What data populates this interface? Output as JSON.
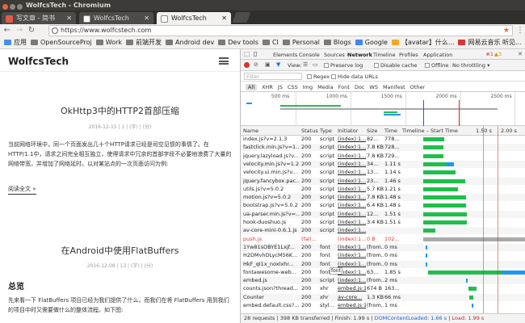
{
  "window": {
    "title": "WolfcsTech - Chromium"
  },
  "tabs": [
    {
      "label": "写文章 - 简书",
      "favicon": "red"
    },
    {
      "label": "WolfcsTech",
      "favicon": "doc"
    },
    {
      "label": "WolfcsTech",
      "favicon": "doc",
      "active": true
    }
  ],
  "toolbar": {
    "url": "https://www.wolfcstech.com"
  },
  "bookmarks": [
    {
      "label": "应用",
      "icon": "apps"
    },
    {
      "label": "OpenSourceProj",
      "icon": "folder"
    },
    {
      "label": "Work",
      "icon": "folder"
    },
    {
      "label": "前端开发",
      "icon": "folder"
    },
    {
      "label": "Android dev",
      "icon": "folder"
    },
    {
      "label": "Dev tools",
      "icon": "folder"
    },
    {
      "label": "CI",
      "icon": "folder"
    },
    {
      "label": "Personal",
      "icon": "folder"
    },
    {
      "label": "Blogs",
      "icon": "folder"
    },
    {
      "label": "Google",
      "icon": "g"
    },
    {
      "label": "【avatar】什么...",
      "icon": "page"
    },
    {
      "label": "网易云音乐 听见...",
      "icon": "music"
    }
  ],
  "site": {
    "title": "WolfcsTech",
    "post1": {
      "title": "OkHttp3中的HTTP2首部压缩",
      "meta": "2016-12-15 | 1 | (字) | (分)",
      "excerpt": "当前网络环境中，同一个页面发出几十个HTTP请求已经是司空见惯的事情了。在HTTP/1.1中，请求之间完全相互独立，使得请求中冗余的首部字段不必要地浪费了大量的网络带宽，并增加了网络延时。以对某站点的一次页面访问为例:",
      "more": "阅读全文 »"
    },
    "post2": {
      "title": "在Android中使用FlatBuffers",
      "meta": "2016-12-08 | 13 | (字) | (分)",
      "section": "总览",
      "excerpt": "先来看一下 FlatBuffers 项目已经为我们提供了什么，而我们在将 FlatBuffers 用到我们的项目中时又需要做什么的整体流程。如下图:"
    }
  },
  "devtools": {
    "tabs": [
      "Elements",
      "Console",
      "Sources",
      "Network",
      "Timeline",
      "Profiles",
      "Application"
    ],
    "active_tab": "Network",
    "errors": "1",
    "warnings": "3",
    "view_label": "View:",
    "preserve_log": "Preserve log",
    "disable_cache": "Disable cache",
    "offline": "Offline",
    "throttle": "No throttling",
    "filter_placeholder": "Filter",
    "regex": "Regex",
    "hide_data": "Hide data URLs",
    "types": [
      "All",
      "XHR",
      "JS",
      "CSS",
      "Img",
      "Media",
      "Font",
      "Doc",
      "WS",
      "Manifest",
      "Other"
    ],
    "overview_ticks": [
      "500 ms",
      "1000 ms",
      "1500 ms",
      "2000 ms",
      "2500 ms"
    ],
    "columns": {
      "name": "Name",
      "status": "Status",
      "type": "Type",
      "initiator": "Initiator",
      "size": "Size",
      "time": "Time",
      "waterfall": "Timeline – Start Time",
      "w1": "1.50 s",
      "w2": "2.00 s"
    },
    "rows": [
      {
        "name": "index.js?v=2.1.3",
        "status": "200",
        "type": "script",
        "init": "(index):1...",
        "size": "82...",
        "time": "778...",
        "start": 0.14,
        "dur": 0.18,
        "color": "green"
      },
      {
        "name": "fastclick.min.js?v=1...",
        "status": "200",
        "type": "script",
        "init": "(index):1...",
        "size": "7.8 KB",
        "time": "728...",
        "start": 0.14,
        "dur": 0.17,
        "color": "green"
      },
      {
        "name": "jquery.lazyload.js?v...",
        "status": "200",
        "type": "script",
        "init": "(index):1...",
        "size": "7.8 KB",
        "time": "729...",
        "start": 0.14,
        "dur": 0.17,
        "color": "green"
      },
      {
        "name": "velocity.min.js?v=1.2.1",
        "status": "200",
        "type": "script",
        "init": "(index):1...",
        "size": "34...",
        "time": "1.11 s",
        "start": 0.14,
        "dur": 0.26,
        "color": "green_blue"
      },
      {
        "name": "velocity.ui.min.js?v...",
        "status": "200",
        "type": "script",
        "init": "(index):1...",
        "size": "13...",
        "time": "1.14 s",
        "start": 0.14,
        "dur": 0.27,
        "color": "green"
      },
      {
        "name": "jquery.fancybox.pac...",
        "status": "200",
        "type": "script",
        "init": "(index):1...",
        "size": "23...",
        "time": "1.46 s",
        "start": 0.14,
        "dur": 0.35,
        "color": "green"
      },
      {
        "name": "utils.js?v=5.0.2",
        "status": "200",
        "type": "script",
        "init": "(index):1...",
        "size": "5.7 KB",
        "time": "1.21 s",
        "start": 0.14,
        "dur": 0.29,
        "color": "green"
      },
      {
        "name": "motion.js?v=5.0.2",
        "status": "200",
        "type": "script",
        "init": "(index):1...",
        "size": "7.8 KB",
        "time": "1.48 s",
        "start": 0.14,
        "dur": 0.36,
        "color": "green"
      },
      {
        "name": "bootstrap.js?v=5.0.2",
        "status": "200",
        "type": "script",
        "init": "(index):1...",
        "size": "6.4 KB",
        "time": "1.48 s",
        "start": 0.14,
        "dur": 0.36,
        "color": "green"
      },
      {
        "name": "ua-parser.min.js?v=...",
        "status": "200",
        "type": "script",
        "init": "(index):1...",
        "size": "12...",
        "time": "1.51 s",
        "start": 0.14,
        "dur": 0.37,
        "color": "green"
      },
      {
        "name": "hook-duoshuo.js",
        "status": "200",
        "type": "script",
        "init": "(index):1...",
        "size": "3.4 KB",
        "time": "1.51 s",
        "start": 0.14,
        "dur": 0.37,
        "color": "green"
      },
      {
        "name": "av-core-mini-0.6.1.js",
        "status": "200",
        "type": "script",
        "init": "(index):1...",
        "size": "",
        "time": "",
        "start": 0.14,
        "dur": 0.1,
        "color": "green"
      },
      {
        "name": "push.js",
        "status": "(fail...",
        "type": "",
        "init": "(index):1...",
        "size": "0 B",
        "time": "102...",
        "start": 0.14,
        "dur": 0.86,
        "color": "gray",
        "failed": true
      },
      {
        "name": "1Yw81sOBYE1Lxjf...",
        "status": "200",
        "type": "font",
        "init": "(index):1...",
        "size": "(from...",
        "time": "0 ms",
        "start": 0.16,
        "dur": 0.01,
        "color": "blue"
      },
      {
        "name": "H2DMvhDLycM56K...",
        "status": "200",
        "type": "font",
        "init": "(index):1...",
        "size": "(from...",
        "time": "0 ms",
        "start": 0.16,
        "dur": 0.01,
        "color": "blue"
      },
      {
        "name": "HkF_qI1x_noxlxhr...",
        "status": "200",
        "type": "font",
        "init": "(index):1...",
        "size": "(from...",
        "time": "0 ms",
        "start": 0.16,
        "dur": 0.01,
        "color": "blue"
      },
      {
        "name": "fontawesome-web...",
        "status": "200",
        "type": "font",
        "init": "(index):1...",
        "size": "63...",
        "time": "1.85 s",
        "start": 0.18,
        "dur": 0.82,
        "color": "green_blue"
      },
      {
        "name": "embed.js",
        "status": "200",
        "type": "script",
        "init": "(index):1...",
        "size": "(from...",
        "time": "2 ms",
        "start": 0.5,
        "dur": 0.01,
        "color": "blue"
      },
      {
        "name": "counts.json?thread...",
        "status": "200",
        "type": "xhr",
        "init": "embed.js:1",
        "size": "674 B",
        "time": "163...",
        "start": 0.52,
        "dur": 0.07,
        "color": "green"
      },
      {
        "name": "Counter",
        "status": "200",
        "type": "xhr",
        "init": "av-core...",
        "size": "1.3 KB",
        "time": "66 ms",
        "start": 0.53,
        "dur": 0.03,
        "color": "green"
      },
      {
        "name": "embed.default.css?...",
        "status": "200",
        "type": "styl...",
        "init": "embed.js:1",
        "size": "(from...",
        "time": "1 ms",
        "start": 0.55,
        "dur": 0.01,
        "color": "blue"
      }
    ],
    "tooltip": "font",
    "status": {
      "requests": "28 requests",
      "transferred": "398 KB transferred",
      "finish": "Finish: 1.99 s",
      "dcl": "DOMContentLoaded: 1.66 s",
      "load": "Load: 1.99 s"
    },
    "colors": {
      "green": "#1fbf4a",
      "blue": "#2196f3",
      "gray": "#a9a9a9",
      "dcl": "#1a5fd4",
      "load": "#c22"
    }
  }
}
